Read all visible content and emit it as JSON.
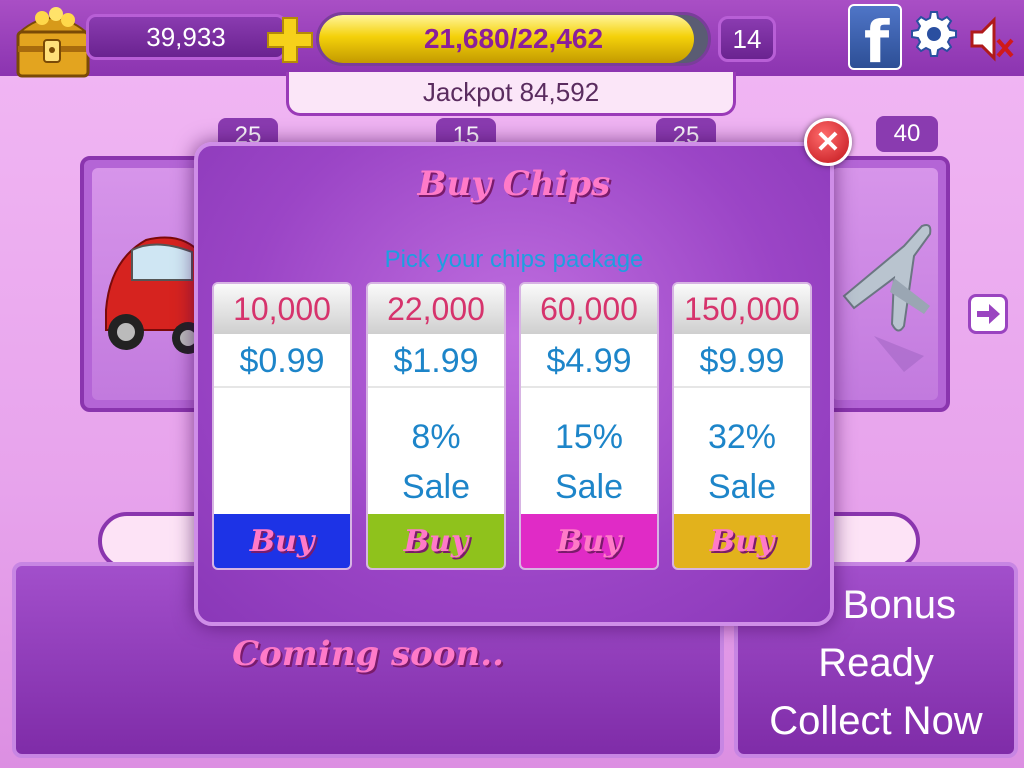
{
  "header": {
    "coins": "39,933",
    "xp_text": "21,680/22,462",
    "xp_progress": 0.965,
    "level": "14",
    "jackpot": "Jackpot 84,592"
  },
  "rooms": {
    "badges": [
      "25",
      "15",
      "25",
      "40"
    ]
  },
  "bottom": {
    "coming_soon": "Coming soon..",
    "bonus_line1": "er Bonus",
    "bonus_line2": "Ready",
    "bonus_line3": "Collect Now"
  },
  "modal": {
    "title": "Buy Chips",
    "subtitle": "Pick your chips package",
    "packages": [
      {
        "chips": "10,000",
        "price": "$0.99",
        "sale_pct": "",
        "sale_label": "",
        "buy": "Buy",
        "color": "#1d33e6"
      },
      {
        "chips": "22,000",
        "price": "$1.99",
        "sale_pct": "8%",
        "sale_label": "Sale",
        "buy": "Buy",
        "color": "#8fc21c"
      },
      {
        "chips": "60,000",
        "price": "$4.99",
        "sale_pct": "15%",
        "sale_label": "Sale",
        "buy": "Buy",
        "color": "#e02bc6"
      },
      {
        "chips": "150,000",
        "price": "$9.99",
        "sale_pct": "32%",
        "sale_label": "Sale",
        "buy": "Buy",
        "color": "#e2b21c"
      }
    ]
  },
  "icons": {
    "chest": "treasure-chest-icon",
    "plus": "plus-icon",
    "facebook": "facebook-icon",
    "settings": "gear-icon",
    "sound": "mute-icon",
    "close": "close-icon",
    "next": "arrow-right-icon"
  }
}
